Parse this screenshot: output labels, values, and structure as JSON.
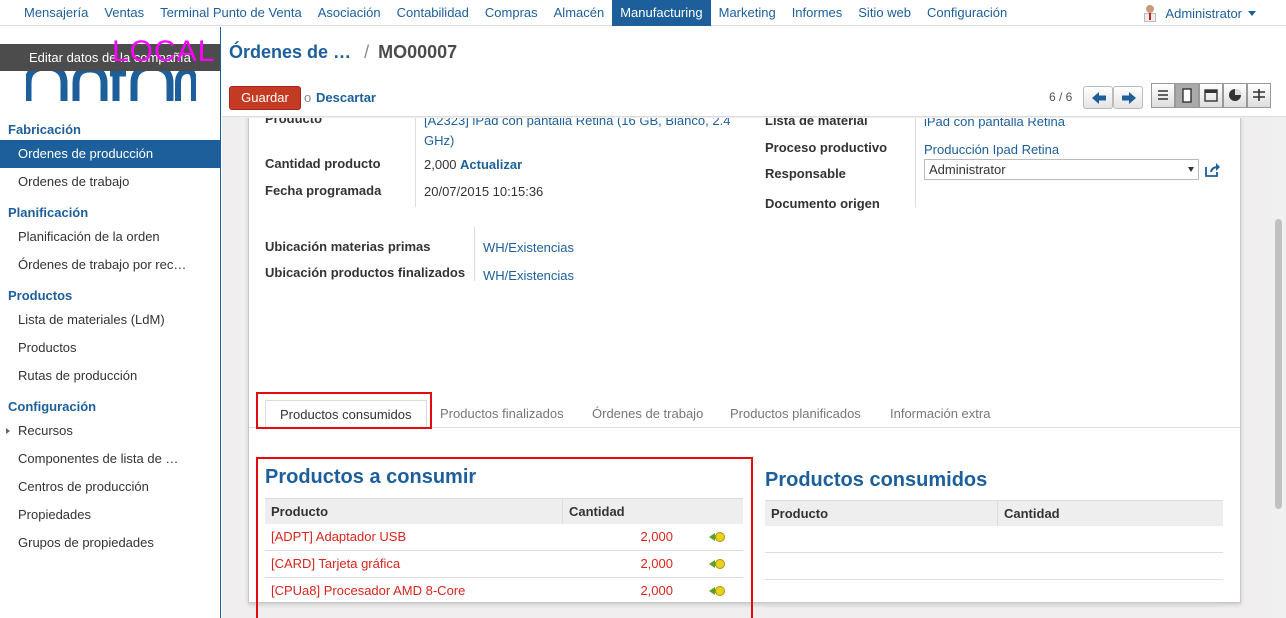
{
  "topmenu": {
    "items": [
      "Mensajería",
      "Ventas",
      "Terminal Punto de Venta",
      "Asociación",
      "Contabilidad",
      "Compras",
      "Almacén",
      "Manufacturing",
      "Marketing",
      "Informes",
      "Sitio web",
      "Configuración"
    ],
    "active": "Manufacturing",
    "user": "Administrator"
  },
  "sidebar": {
    "edit_company": "Editar datos de la compañía",
    "env_badge": "LOCAL",
    "sections": [
      {
        "title": "Fabricación",
        "items": [
          "Ordenes de producción",
          "Ordenes de trabajo"
        ]
      },
      {
        "title": "Planificación",
        "items": [
          "Planificación de la orden",
          "Órdenes de trabajo por rec…"
        ]
      },
      {
        "title": "Productos",
        "items": [
          "Lista de materiales (LdM)",
          "Productos",
          "Rutas de producción"
        ]
      },
      {
        "title": "Configuración",
        "items": [
          "Recursos",
          "Componentes de lista de …",
          "Centros de producción",
          "Propiedades",
          "Grupos de propiedades"
        ]
      }
    ],
    "active_item": "Ordenes de producción"
  },
  "header": {
    "breadcrumb_parent": "Órdenes de …",
    "breadcrumb_sep": "/",
    "breadcrumb_current": "MO00007",
    "save_label": "Guardar",
    "or_label": "o",
    "discard_label": "Descartar",
    "pager": "6 / 6"
  },
  "form": {
    "product_label": "Producto",
    "product_value": "[A2323] iPad con pantalla Retina (16 GB, Blanco, 2.4 GHz)",
    "qty_label": "Cantidad producto",
    "qty_value": "2,000",
    "update_label": "Actualizar",
    "date_label": "Fecha programada",
    "date_value": "20/07/2015 10:15:36",
    "bom_label": "Lista de material",
    "bom_value": "iPad con pantalla Retina",
    "routing_label": "Proceso productivo",
    "routing_value": "Producción Ipad Retina",
    "responsible_label": "Responsable",
    "responsible_value": "Administrator",
    "origin_label": "Documento origen",
    "origin_value": "",
    "raw_loc_label": "Ubicación materias primas",
    "raw_loc_value": "WH/Existencias",
    "fin_loc_label": "Ubicación productos finalizados",
    "fin_loc_value": "WH/Existencias"
  },
  "tabs": [
    "Productos consumidos",
    "Productos finalizados",
    "Órdenes de trabajo",
    "Productos planificados",
    "Información extra"
  ],
  "to_consume": {
    "title": "Productos a consumir",
    "col_product": "Producto",
    "col_qty": "Cantidad",
    "rows": [
      {
        "product": "[ADPT] Adaptador USB",
        "qty": "2,000"
      },
      {
        "product": "[CARD] Tarjeta gráfica",
        "qty": "2,000"
      },
      {
        "product": "[CPUa8] Procesador AMD 8-Core",
        "qty": "2,000"
      }
    ]
  },
  "consumed": {
    "title": "Productos consumidos",
    "col_product": "Producto",
    "col_qty": "Cantidad"
  },
  "colors": {
    "accent": "#1c5f9b",
    "highlight": "#e3090f",
    "save": "#c23b22",
    "pending_row": "#d9261c"
  }
}
